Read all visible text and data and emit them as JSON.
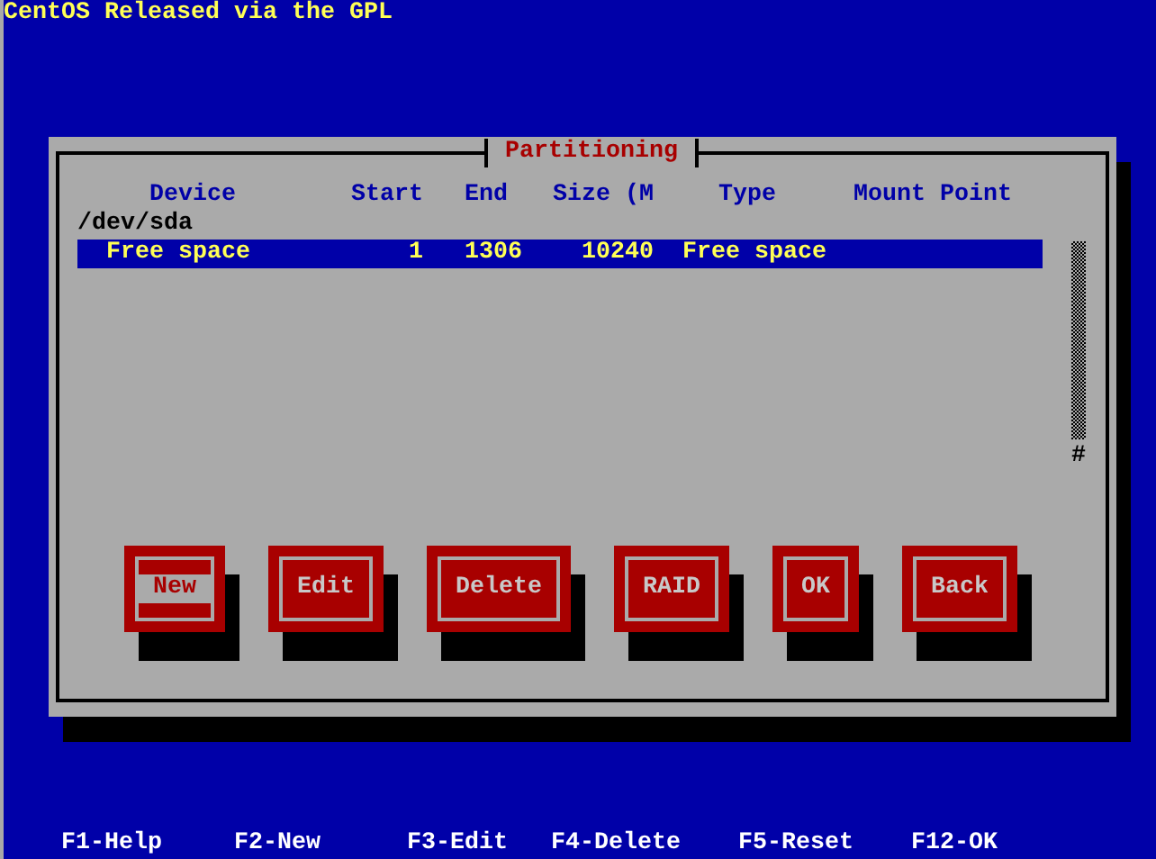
{
  "banner": "CentOS Released via the GPL",
  "dialog": {
    "title": "Partitioning",
    "columns": [
      "Device",
      "Start",
      "End",
      "Size (M",
      "Type",
      "Mount Point"
    ],
    "drives": [
      {
        "name": "/dev/sda",
        "children": [
          {
            "device": "Free space",
            "start": "1",
            "end": "1306",
            "size": "10240",
            "type": "Free space",
            "selected": true
          }
        ]
      }
    ],
    "scroll_thumb": "#",
    "buttons": [
      {
        "label": "New",
        "focused": true
      },
      {
        "label": "Edit",
        "focused": false
      },
      {
        "label": "Delete",
        "focused": false
      },
      {
        "label": "RAID",
        "focused": false
      },
      {
        "label": "OK",
        "focused": false
      },
      {
        "label": "Back",
        "focused": false
      }
    ]
  },
  "hotkeys": [
    "F1-Help",
    "F2-New",
    "F3-Edit",
    "F4-Delete",
    "F5-Reset",
    "F12-OK"
  ]
}
